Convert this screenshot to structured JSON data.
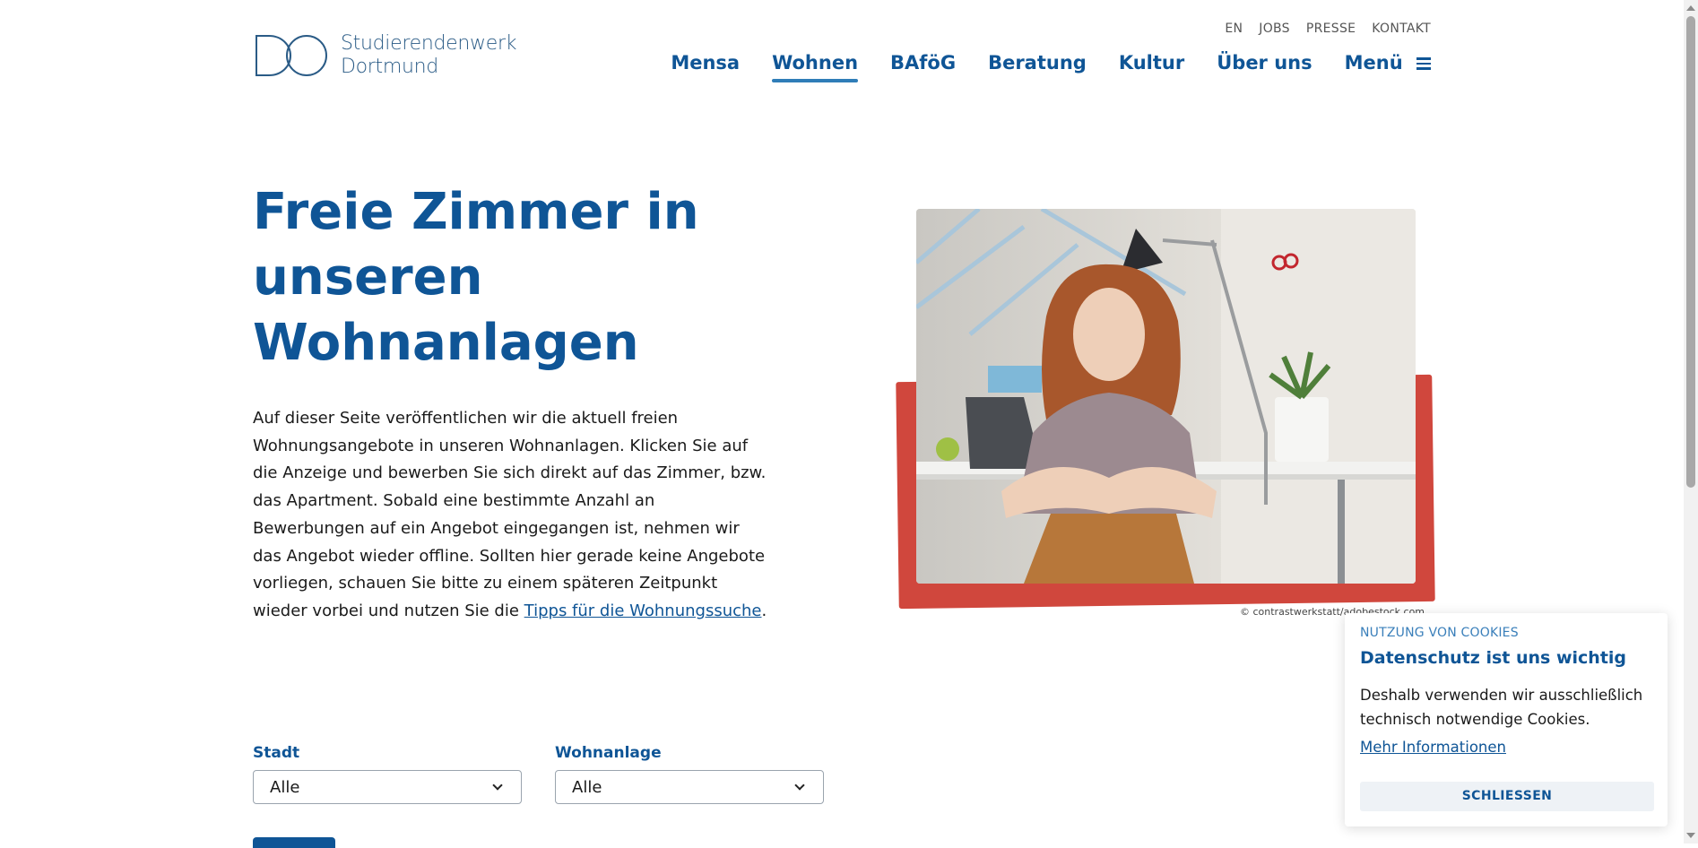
{
  "header": {
    "logo_initials": "DO",
    "logo_line1": "Studierendenwerk",
    "logo_line2": "Dortmund",
    "utility_nav": [
      "EN",
      "JOBS",
      "PRESSE",
      "KONTAKT"
    ],
    "main_nav": [
      {
        "label": "Mensa",
        "active": false
      },
      {
        "label": "Wohnen",
        "active": true
      },
      {
        "label": "BAföG",
        "active": false
      },
      {
        "label": "Beratung",
        "active": false
      },
      {
        "label": "Kultur",
        "active": false
      },
      {
        "label": "Über uns",
        "active": false
      },
      {
        "label": "Menü",
        "active": false
      }
    ]
  },
  "hero": {
    "title_line1": "Freie Zimmer in",
    "title_line2": "unseren",
    "title_line3": "Wohnanlagen",
    "text_before_link": "Auf dieser Seite veröffentlichen wir die aktuell freien Wohnungsangebote in unseren Wohnanlagen. Klicken Sie auf die Anzeige und bewerben Sie sich direkt auf das Zimmer, bzw. das Apartment. Sobald eine bestimmte Anzahl an Bewerbungen auf ein Angebot eingegangen ist, nehmen wir das Angebot wieder offline. Sollten hier gerade keine Angebote vorliegen, schauen Sie bitte zu einem späteren Zeitpunkt wieder vorbei und nutzen Sie die ",
    "link_text": "Tipps für die Wohnungssuche",
    "text_after_link": ".",
    "image_credit": "© contrastwerkstatt/adobestock.com"
  },
  "filters": {
    "city_label": "Stadt",
    "city_value": "Alle",
    "residence_label": "Wohnanlage",
    "residence_value": "Alle"
  },
  "cookie": {
    "eyebrow": "NUTZUNG VON COOKIES",
    "title": "Datenschutz ist uns wichtig",
    "body": "Deshalb verwenden wir ausschließlich technisch notwendige Cookies.",
    "more_link": "Mehr Informationen",
    "close_label": "SCHLIESSEN"
  },
  "colors": {
    "brand_blue": "#0f5596",
    "frame_red": "#d0473d",
    "link_blue": "#3a7fba"
  }
}
